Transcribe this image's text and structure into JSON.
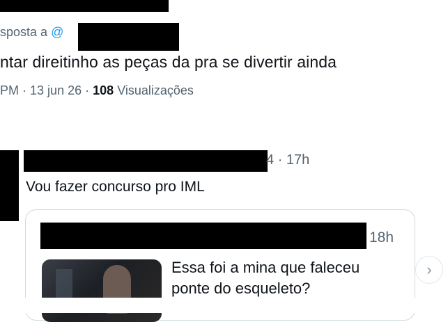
{
  "tweet": {
    "reply_prefix": "sposta a",
    "reply_handle": "@",
    "text": "ntar direitinho as peças da pra se divertir ainda",
    "meta_time": "PM",
    "meta_date": "13 jun 26",
    "meta_views_count": "108",
    "meta_views_label": "Visualizações",
    "separator": "·"
  },
  "reply": {
    "time_prefix": "4",
    "time": "17h",
    "text": "Vou fazer concurso pro IML"
  },
  "quoted": {
    "time": "18h",
    "text_line1": "Essa foi a mina que faleceu",
    "text_line2": "ponte do esqueleto?"
  },
  "icons": {
    "next": "chevron-right-icon"
  },
  "colors": {
    "text": "#0f1419",
    "muted": "#536471",
    "link": "#1d9bf0",
    "border": "#cfd9de",
    "redaction": "#000000"
  }
}
